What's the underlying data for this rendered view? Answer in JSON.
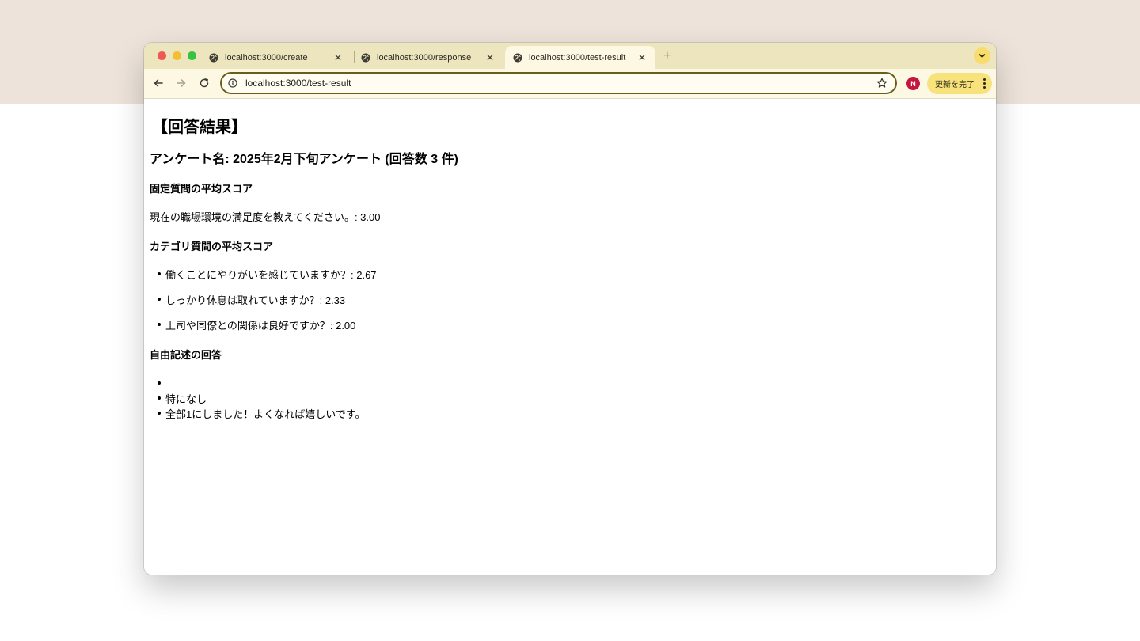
{
  "browser": {
    "tabs": [
      {
        "title": "localhost:3000/create",
        "active": false
      },
      {
        "title": "localhost:3000/response",
        "active": false
      },
      {
        "title": "localhost:3000/test-result",
        "active": true
      }
    ],
    "new_tab_label": "+",
    "url": "localhost:3000/test-result",
    "profile_initial": "N",
    "update_button_label": "更新を完了",
    "colors": {
      "tabstrip": "#ece5bd",
      "toolbar": "#fdf8e3",
      "omnibox_border": "#6a5f19",
      "avatar": "#c4163e",
      "update_button": "#f8e27c"
    }
  },
  "page": {
    "title": "【回答結果】",
    "survey_heading": "アンケート名: 2025年2月下旬アンケート (回答数 3 件)",
    "fixed_section": {
      "heading": "固定質問の平均スコア",
      "item": "現在の職場環境の満足度を教えてください。: 3.00"
    },
    "category_section": {
      "heading": "カテゴリ質問の平均スコア",
      "items": [
        "働くことにやりがいを感じていますか？: 2.67",
        "しっかり休息は取れていますか？: 2.33",
        "上司や同僚との関係は良好ですか？: 2.00"
      ]
    },
    "free_text_section": {
      "heading": "自由記述の回答",
      "items": [
        "",
        "特になし",
        "全部1にしました！よくなれば嬉しいです。"
      ]
    }
  }
}
